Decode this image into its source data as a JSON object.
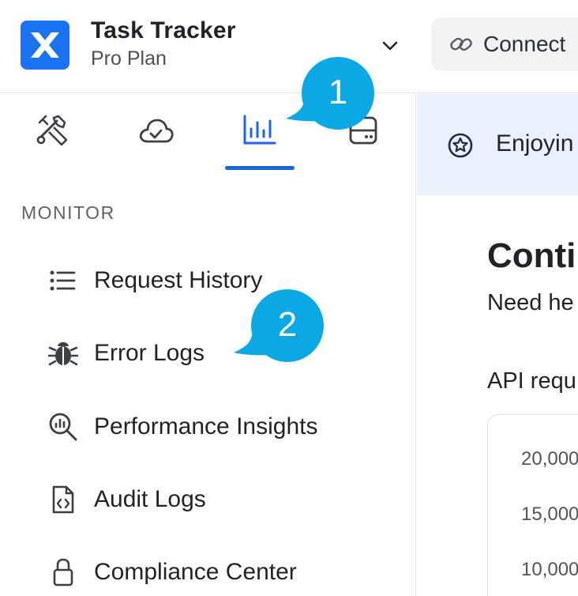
{
  "header": {
    "app_title": "Task Tracker",
    "plan": "Pro Plan",
    "connect_label": "Connect"
  },
  "sidebar": {
    "tabs": [
      {
        "name": "tools",
        "icon": "tools-icon"
      },
      {
        "name": "cloud",
        "icon": "cloud-check-icon"
      },
      {
        "name": "analytics",
        "icon": "bar-chart-icon",
        "active": true
      },
      {
        "name": "storage",
        "icon": "server-icon"
      }
    ],
    "section_label": "MONITOR",
    "items": [
      {
        "label": "Request History",
        "icon": "list-icon"
      },
      {
        "label": "Error Logs",
        "icon": "bug-icon"
      },
      {
        "label": "Performance Insights",
        "icon": "search-chart-icon"
      },
      {
        "label": "Audit Logs",
        "icon": "code-file-icon"
      },
      {
        "label": "Compliance Center",
        "icon": "lock-icon"
      }
    ]
  },
  "main": {
    "banner_text": "Enjoyin",
    "title": "Conti",
    "subtitle": "Need he",
    "chart_title": "API requ",
    "y_ticks": [
      "20,000",
      "15,000",
      "10,000"
    ]
  },
  "callouts": [
    "1",
    "2"
  ],
  "colors": {
    "accent": "#1a66e8",
    "callout": "#0ba8e6",
    "banner": "#eaf0fe",
    "logo": "#1a73f0"
  }
}
